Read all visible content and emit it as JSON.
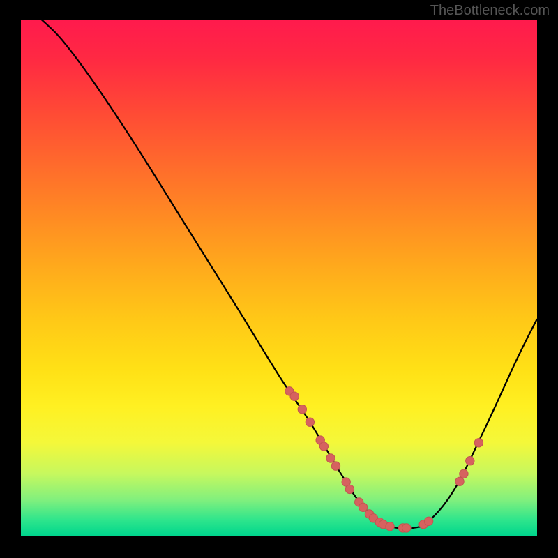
{
  "watermark": "TheBottleneck.com",
  "colors": {
    "curve": "#000000",
    "marker_fill": "#d6625f",
    "marker_stroke": "#c25551",
    "background_black": "#000000"
  },
  "chart_data": {
    "type": "line",
    "xlim": [
      0,
      100
    ],
    "ylim": [
      0,
      100
    ],
    "curve": [
      {
        "x": 4,
        "y": 100
      },
      {
        "x": 8,
        "y": 96
      },
      {
        "x": 14,
        "y": 88
      },
      {
        "x": 22,
        "y": 76
      },
      {
        "x": 32,
        "y": 60
      },
      {
        "x": 42,
        "y": 44
      },
      {
        "x": 50,
        "y": 31
      },
      {
        "x": 56,
        "y": 22
      },
      {
        "x": 62,
        "y": 12
      },
      {
        "x": 66,
        "y": 6
      },
      {
        "x": 70,
        "y": 2.5
      },
      {
        "x": 73,
        "y": 1.5
      },
      {
        "x": 76,
        "y": 1.5
      },
      {
        "x": 79,
        "y": 2.8
      },
      {
        "x": 84,
        "y": 9
      },
      {
        "x": 90,
        "y": 21
      },
      {
        "x": 96,
        "y": 34
      },
      {
        "x": 100,
        "y": 42
      }
    ],
    "markers": [
      {
        "x": 52,
        "y": 28
      },
      {
        "x": 53,
        "y": 27
      },
      {
        "x": 54.5,
        "y": 24.5
      },
      {
        "x": 56,
        "y": 22
      },
      {
        "x": 58,
        "y": 18.5
      },
      {
        "x": 58.7,
        "y": 17.3
      },
      {
        "x": 60,
        "y": 15
      },
      {
        "x": 61,
        "y": 13.5
      },
      {
        "x": 63,
        "y": 10.4
      },
      {
        "x": 63.7,
        "y": 9
      },
      {
        "x": 65.5,
        "y": 6.5
      },
      {
        "x": 66.3,
        "y": 5.5
      },
      {
        "x": 67.5,
        "y": 4.2
      },
      {
        "x": 68.3,
        "y": 3.4
      },
      {
        "x": 69.5,
        "y": 2.6
      },
      {
        "x": 70.2,
        "y": 2.2
      },
      {
        "x": 71.5,
        "y": 1.8
      },
      {
        "x": 74,
        "y": 1.5
      },
      {
        "x": 74.7,
        "y": 1.5
      },
      {
        "x": 78,
        "y": 2.2
      },
      {
        "x": 79,
        "y": 2.8
      },
      {
        "x": 85,
        "y": 10.5
      },
      {
        "x": 85.8,
        "y": 12
      },
      {
        "x": 87,
        "y": 14.5
      },
      {
        "x": 88.7,
        "y": 18
      }
    ],
    "gradient_stops": [
      {
        "pos": 0,
        "color": "#ff1a4d"
      },
      {
        "pos": 8,
        "color": "#ff2a42"
      },
      {
        "pos": 18,
        "color": "#ff4a35"
      },
      {
        "pos": 28,
        "color": "#ff6a2c"
      },
      {
        "pos": 38,
        "color": "#ff8a23"
      },
      {
        "pos": 48,
        "color": "#ffaa1c"
      },
      {
        "pos": 58,
        "color": "#ffc817"
      },
      {
        "pos": 68,
        "color": "#ffe116"
      },
      {
        "pos": 75,
        "color": "#fff022"
      },
      {
        "pos": 82,
        "color": "#f4f83a"
      },
      {
        "pos": 88,
        "color": "#c6f85e"
      },
      {
        "pos": 93,
        "color": "#82f07d"
      },
      {
        "pos": 97,
        "color": "#2de58c"
      },
      {
        "pos": 100,
        "color": "#00d68d"
      }
    ]
  }
}
